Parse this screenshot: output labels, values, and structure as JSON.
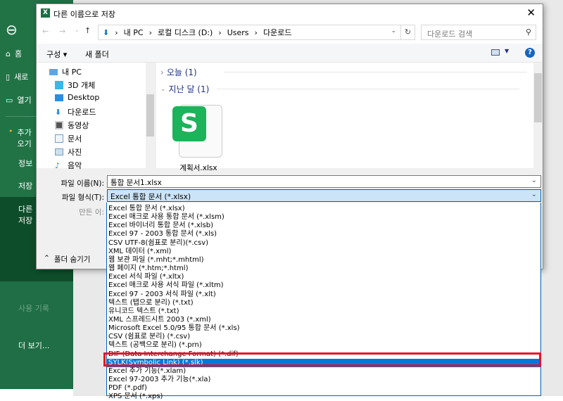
{
  "sidebar": {
    "items": [
      {
        "label": "홈"
      },
      {
        "label": "새로"
      },
      {
        "label": "열기"
      },
      {
        "label": "추가 오기"
      },
      {
        "label": "정보"
      },
      {
        "label": "저장"
      },
      {
        "label": "다른 저장"
      },
      {
        "label": "사용 기록"
      },
      {
        "label": "더 보기..."
      }
    ]
  },
  "dialog": {
    "title": "다른 이름으로 저장",
    "breadcrumb": [
      "내 PC",
      "로컬 디스크 (D:)",
      "Users",
      "다운로드"
    ],
    "search_placeholder": "다운로드 검색",
    "organize": "구성 ▾",
    "new_folder": "새 폴더",
    "nav": [
      "내 PC",
      "3D 개체",
      "Desktop",
      "다운로드",
      "동영상",
      "문서",
      "사진",
      "음악"
    ],
    "groups": [
      "오늘 (1)",
      "지난 달 (1)"
    ],
    "file": {
      "name": "계획서.xlsx"
    },
    "filename_label": "파일 이름(N):",
    "filename_value": "통합 문서1.xlsx",
    "filetype_label": "파일 형식(T):",
    "filetype_value": "Excel 통합 문서 (*.xlsx)",
    "author_label": "만든 이:",
    "hide_folders": "폴더 숨기기"
  },
  "filetype_options": [
    "Excel 통합 문서 (*.xlsx)",
    "Excel 매크로 사용 통합 문서 (*.xlsm)",
    "Excel 바이너리 통합 문서 (*.xlsb)",
    "Excel 97 - 2003 통합 문서 (*.xls)",
    "CSV UTF-8(쉼표로 분리)(*.csv)",
    "XML 데이터 (*.xml)",
    "웹 보관 파일 (*.mht;*.mhtml)",
    "웹 페이지 (*.htm;*.html)",
    "Excel 서식 파일 (*.xltx)",
    "Excel 매크로 사용 서식 파일 (*.xltm)",
    "Excel 97 - 2003 서식 파일 (*.xlt)",
    "텍스트 (탭으로 분리) (*.txt)",
    "유니코드 텍스트 (*.txt)",
    "XML 스프레드시트 2003 (*.xml)",
    "Microsoft Excel 5.0/95 통합 문서 (*.xls)",
    "CSV (쉼표로 분리) (*.csv)",
    "텍스트 (공백으로 분리) (*.prn)",
    "DIF (Data Interchange Format) (*.dif)",
    "SYLK(Symbolic Link) (*.slk)",
    "Excel 추가 기능(*.xlam)",
    "Excel 97-2003 추가 기능(*.xla)",
    "PDF (*.pdf)",
    "XPS 문서 (*.xps)"
  ],
  "highlighted_index": 18,
  "colors": {
    "excel_green": "#217346",
    "highlight": "#0078d7",
    "callout": "#e81123"
  }
}
